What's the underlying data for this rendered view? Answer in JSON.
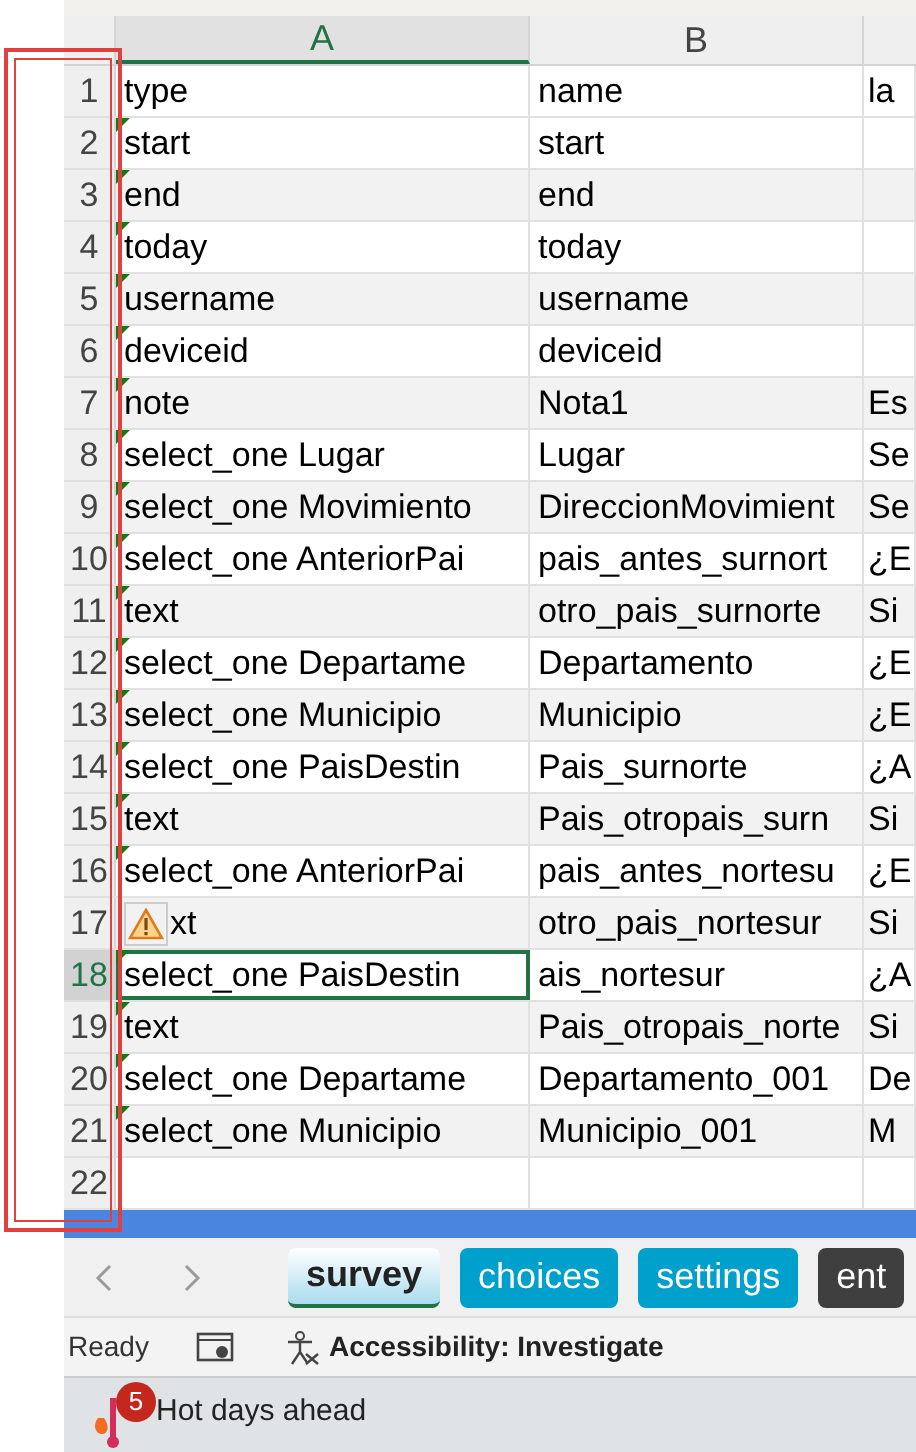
{
  "columns": [
    {
      "label": "A",
      "selected": true
    },
    {
      "label": "B",
      "selected": false
    }
  ],
  "rows": [
    {
      "number": "1",
      "cells": [
        "type",
        "name",
        "la"
      ],
      "flag": false,
      "warning": false,
      "selected": false
    },
    {
      "number": "2",
      "cells": [
        "start",
        "start",
        ""
      ],
      "flag": true,
      "warning": false,
      "selected": false
    },
    {
      "number": "3",
      "cells": [
        "end",
        "end",
        ""
      ],
      "flag": true,
      "warning": false,
      "selected": false
    },
    {
      "number": "4",
      "cells": [
        "today",
        "today",
        ""
      ],
      "flag": true,
      "warning": false,
      "selected": false
    },
    {
      "number": "5",
      "cells": [
        "username",
        "username",
        ""
      ],
      "flag": true,
      "warning": false,
      "selected": false
    },
    {
      "number": "6",
      "cells": [
        "deviceid",
        "deviceid",
        ""
      ],
      "flag": true,
      "warning": false,
      "selected": false
    },
    {
      "number": "7",
      "cells": [
        "note",
        "Nota1",
        "Es"
      ],
      "flag": true,
      "warning": false,
      "selected": false
    },
    {
      "number": "8",
      "cells": [
        "select_one Lugar",
        "Lugar",
        "Se"
      ],
      "flag": true,
      "warning": false,
      "selected": false
    },
    {
      "number": "9",
      "cells": [
        "select_one Movimiento",
        "DireccionMovimient",
        "Se"
      ],
      "flag": true,
      "warning": false,
      "selected": false
    },
    {
      "number": "10",
      "cells": [
        "select_one AnteriorPai",
        "pais_antes_surnort",
        "¿E"
      ],
      "flag": true,
      "warning": false,
      "selected": false
    },
    {
      "number": "11",
      "cells": [
        "text",
        "otro_pais_surnorte",
        "Si"
      ],
      "flag": true,
      "warning": false,
      "selected": false
    },
    {
      "number": "12",
      "cells": [
        "select_one Departame",
        "Departamento",
        "¿E"
      ],
      "flag": true,
      "warning": false,
      "selected": false
    },
    {
      "number": "13",
      "cells": [
        "select_one Municipio",
        "Municipio",
        "¿E"
      ],
      "flag": true,
      "warning": false,
      "selected": false
    },
    {
      "number": "14",
      "cells": [
        "select_one PaisDestin",
        "Pais_surnorte",
        "¿A"
      ],
      "flag": true,
      "warning": false,
      "selected": false
    },
    {
      "number": "15",
      "cells": [
        "text",
        "Pais_otropais_surn",
        "Si"
      ],
      "flag": true,
      "warning": false,
      "selected": false
    },
    {
      "number": "16",
      "cells": [
        "select_one AnteriorPai",
        "pais_antes_nortesu",
        "¿E"
      ],
      "flag": true,
      "warning": false,
      "selected": false
    },
    {
      "number": "17",
      "cells": [
        "xt",
        "otro_pais_nortesur",
        "Si"
      ],
      "flag": false,
      "warning": true,
      "selected": false
    },
    {
      "number": "18",
      "cells": [
        "select_one PaisDestin",
        "ais_nortesur",
        "¿A"
      ],
      "flag": true,
      "warning": false,
      "selected": true
    },
    {
      "number": "19",
      "cells": [
        "text",
        "Pais_otropais_norte",
        "Si"
      ],
      "flag": true,
      "warning": false,
      "selected": false
    },
    {
      "number": "20",
      "cells": [
        "select_one Departame",
        "Departamento_001",
        "De"
      ],
      "flag": true,
      "warning": false,
      "selected": false
    },
    {
      "number": "21",
      "cells": [
        "select_one Municipio",
        "Municipio_001",
        "M"
      ],
      "flag": true,
      "warning": false,
      "selected": false
    },
    {
      "number": "22",
      "cells": [
        "",
        "",
        ""
      ],
      "flag": false,
      "warning": false,
      "selected": false
    }
  ],
  "sheet_tabs": [
    {
      "label": "survey",
      "selected": true,
      "color": "#a9dcee"
    },
    {
      "label": "choices",
      "selected": false,
      "color": "#00a0cc"
    },
    {
      "label": "settings",
      "selected": false,
      "color": "#00a0cc"
    },
    {
      "label": "ent",
      "selected": false,
      "color": "#3f3f3f"
    }
  ],
  "status_bar": {
    "state": "Ready",
    "accessibility": "Accessibility: Investigate"
  },
  "taskbar": {
    "badge": "5",
    "headline": "Hot days ahead"
  }
}
